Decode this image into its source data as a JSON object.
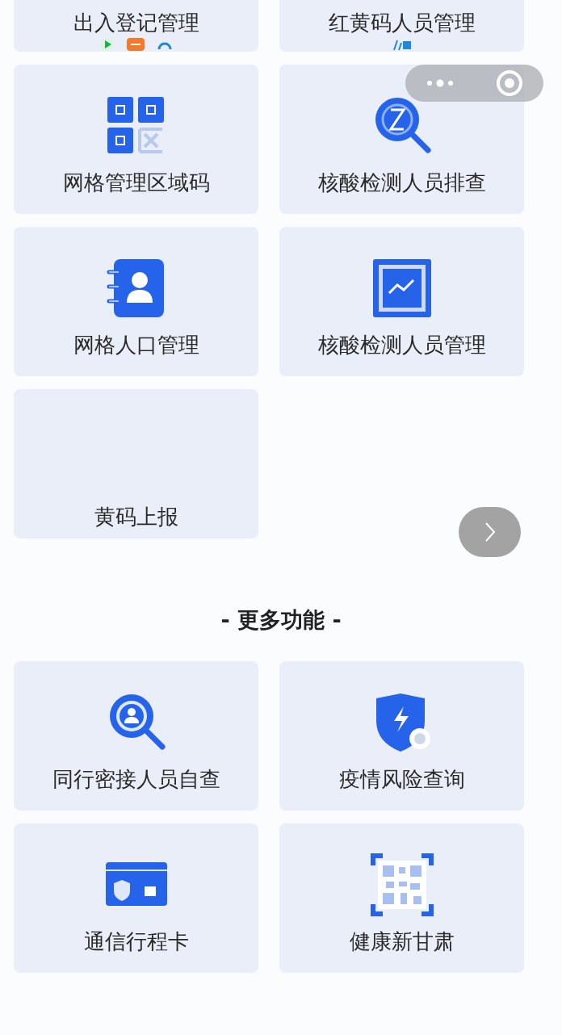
{
  "main_tiles": [
    {
      "label": "出入登记管理",
      "kind": "partial"
    },
    {
      "label": "红黄码人员管理",
      "kind": "partial"
    },
    {
      "label": "网格管理区域码",
      "kind": "icon"
    },
    {
      "label": "核酸检测人员排查",
      "kind": "icon"
    },
    {
      "label": "网格人口管理",
      "kind": "icon"
    },
    {
      "label": "核酸检测人员管理",
      "kind": "icon"
    },
    {
      "label": "黄码上报",
      "kind": "blank"
    }
  ],
  "more_section": {
    "title": "- 更多功能 -",
    "tiles": [
      {
        "label": "同行密接人员自查",
        "kind": "icon"
      },
      {
        "label": "疫情风险查询",
        "kind": "icon"
      },
      {
        "label": "通信行程卡",
        "kind": "icon"
      },
      {
        "label": "健康新甘肃",
        "kind": "icon"
      }
    ]
  }
}
